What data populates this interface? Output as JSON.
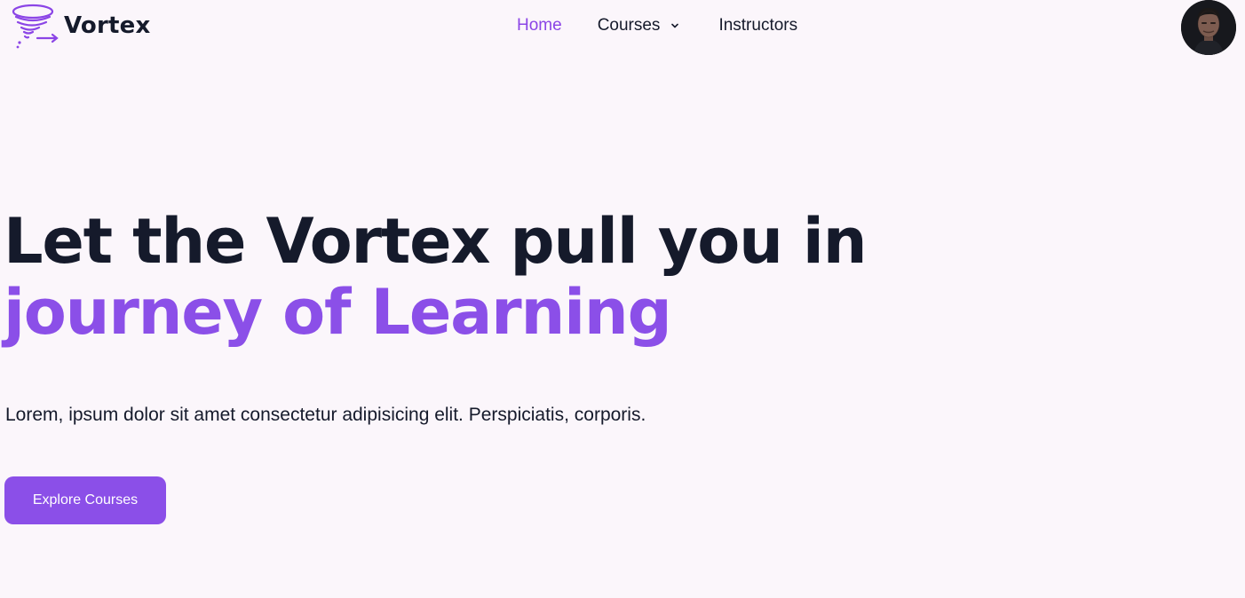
{
  "brand": {
    "name": "Vortex",
    "logo_icon": "tornado-icon"
  },
  "nav": {
    "items": [
      {
        "label": "Home",
        "active": true
      },
      {
        "label": "Courses",
        "has_dropdown": true,
        "dropdown_icon": "chevron-down-icon"
      },
      {
        "label": "Instructors"
      }
    ]
  },
  "user": {
    "avatar_icon": "user-avatar"
  },
  "hero": {
    "title_line_1": "Let the Vortex pull you in",
    "title_line_2": "journey of Learning",
    "description": "Lorem, ipsum dolor sit amet consectetur adipisicing elit. Perspiciatis, corporis.",
    "cta_label": "Explore Courses"
  },
  "colors": {
    "accent": "#8b4fe8",
    "text_dark": "#151a2b",
    "background": "#fbf6fb"
  }
}
